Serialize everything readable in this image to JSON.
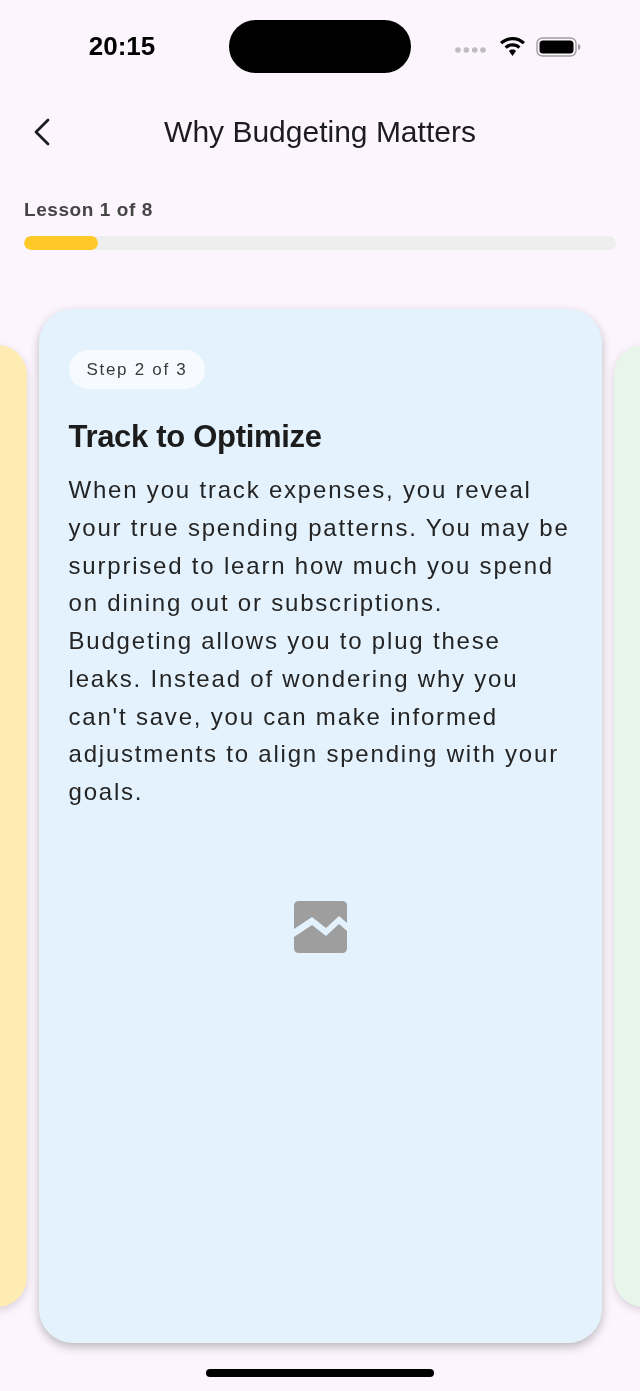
{
  "status_bar": {
    "time": "20:15"
  },
  "header": {
    "title": "Why Budgeting Matters"
  },
  "progress": {
    "label": "Lesson 1 of 8",
    "level": 0.125
  },
  "cards": [
    {
      "color": "#ffecb3",
      "selected": false
    },
    {
      "color": "#e3f2fd",
      "selected": true,
      "badge": "Step 2 of 3",
      "title": "Track to Optimize",
      "body": "When you track expenses, you reveal your true spending patterns. You may be surprised to learn how much you spend on dining out or subscriptions. Budgeting allows you to plug these leaks. Instead of wondering why you can't save, you can make informed adjustments to align spending with your goals."
    },
    {
      "color": "#e8f5e9",
      "selected": false
    }
  ]
}
